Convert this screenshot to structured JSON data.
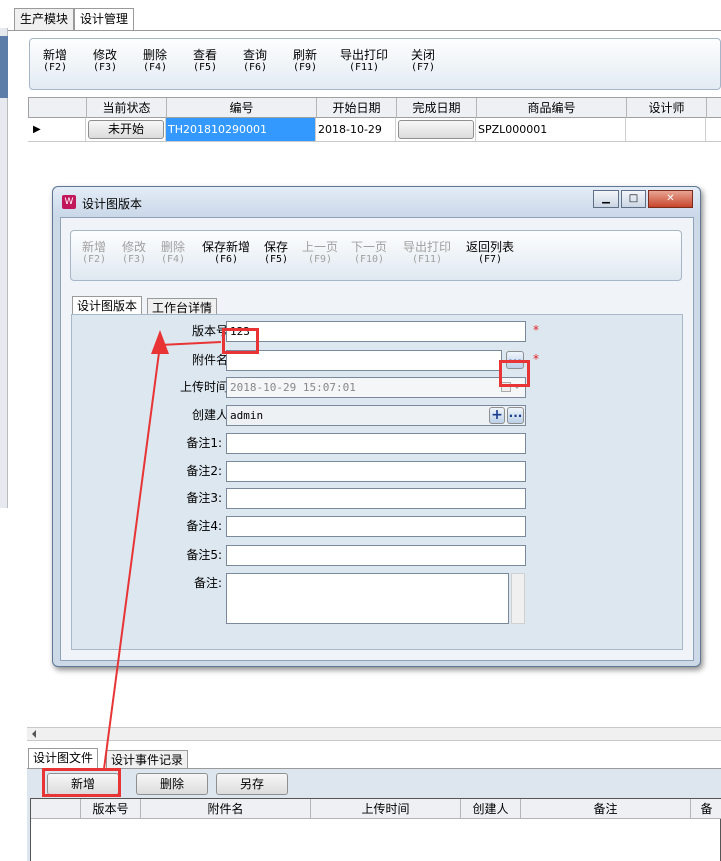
{
  "top_tabs": [
    "生产模块",
    "设计管理"
  ],
  "main_toolbar": [
    {
      "label": "新增",
      "key": "(F2)"
    },
    {
      "label": "修改",
      "key": "(F3)"
    },
    {
      "label": "删除",
      "key": "(F4)"
    },
    {
      "label": "查看",
      "key": "(F5)"
    },
    {
      "label": "查询",
      "key": "(F6)"
    },
    {
      "label": "刷新",
      "key": "(F9)"
    },
    {
      "label": "导出打印",
      "key": "(F11)"
    },
    {
      "label": "关闭",
      "key": "(F7)"
    }
  ],
  "grid": {
    "columns": [
      "当前状态",
      "编号",
      "开始日期",
      "完成日期",
      "商品编号",
      "设计师"
    ],
    "row": {
      "status_button": "未开始",
      "number": "TH201810290001",
      "start_date": "2018-10-29",
      "finish_date": "",
      "product_no": "SPZL000001",
      "designer": ""
    },
    "row_indicator": "▶"
  },
  "dialog": {
    "title": "设计图版本",
    "toolbar": [
      {
        "label": "新增",
        "key": "(F2)",
        "enabled": false
      },
      {
        "label": "修改",
        "key": "(F3)",
        "enabled": false
      },
      {
        "label": "删除",
        "key": "(F4)",
        "enabled": false
      },
      {
        "label": "保存新增",
        "key": "(F6)",
        "enabled": true
      },
      {
        "label": "保存",
        "key": "(F5)",
        "enabled": true
      },
      {
        "label": "上一页",
        "key": "(F9)",
        "enabled": false
      },
      {
        "label": "下一页",
        "key": "(F10)",
        "enabled": false
      },
      {
        "label": "导出打印",
        "key": "(F11)",
        "enabled": false
      },
      {
        "label": "返回列表",
        "key": "(F7)",
        "enabled": true
      }
    ],
    "tabs": [
      "设计图版本",
      "工作台详情"
    ],
    "form": {
      "version_label": "版本号:",
      "version_value": "123",
      "attachment_label": "附件名:",
      "attachment_value": "",
      "upload_label": "上传时间:",
      "upload_value": "2018-10-29 15:07:01",
      "creator_label": "创建人:",
      "creator_value": "admin",
      "note1_label": "备注1:",
      "note2_label": "备注2:",
      "note3_label": "备注3:",
      "note4_label": "备注4:",
      "note5_label": "备注5:",
      "remark_label": "备注:",
      "required_mark": "*",
      "browse_glyph": "...",
      "add_glyph": "+"
    },
    "window_buttons": {
      "minimize": "▁",
      "maximize": "□",
      "close": "✕"
    }
  },
  "bottom": {
    "tabs": [
      "设计图文件",
      "设计事件记录"
    ],
    "buttons": {
      "add": "新增",
      "delete": "删除",
      "save_as": "另存"
    },
    "columns": [
      "版本号",
      "附件名",
      "上传时间",
      "创建人",
      "备注",
      "备"
    ]
  },
  "colors": {
    "selection_blue": "#3399ff",
    "annotation_red": "#e83434"
  }
}
